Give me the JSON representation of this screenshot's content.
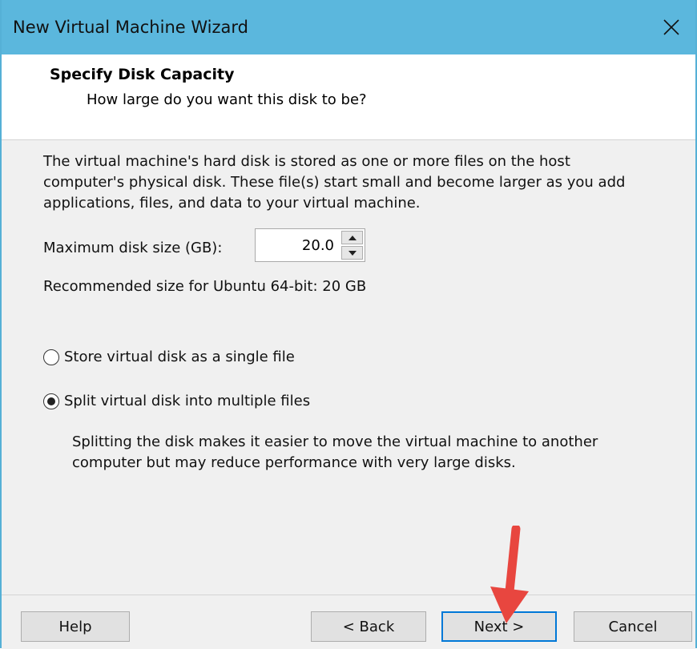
{
  "window": {
    "title": "New Virtual Machine Wizard",
    "close_glyph": "✕"
  },
  "header": {
    "title": "Specify Disk Capacity",
    "subtitle": "How large do you want this disk to be?"
  },
  "content": {
    "description": "The virtual machine's hard disk is stored as one or more files on the host computer's physical disk. These file(s) start small and become larger as you add applications, files, and data to your virtual machine.",
    "max_size_label": "Maximum disk size (GB):",
    "max_size_value": "20.0",
    "recommended": "Recommended size for Ubuntu 64-bit: 20 GB",
    "options": [
      {
        "label": "Store virtual disk as a single file",
        "selected": false
      },
      {
        "label": "Split virtual disk into multiple files",
        "selected": true
      }
    ],
    "split_description": "Splitting the disk makes it easier to move the virtual machine to another computer but may reduce performance with very large disks."
  },
  "buttons": {
    "help": "Help",
    "back": "< Back",
    "next": "Next >",
    "cancel": "Cancel"
  },
  "colors": {
    "titlebar": "#5bb7dd",
    "focus_border": "#0078d7",
    "annotation_arrow": "#e8463f"
  }
}
